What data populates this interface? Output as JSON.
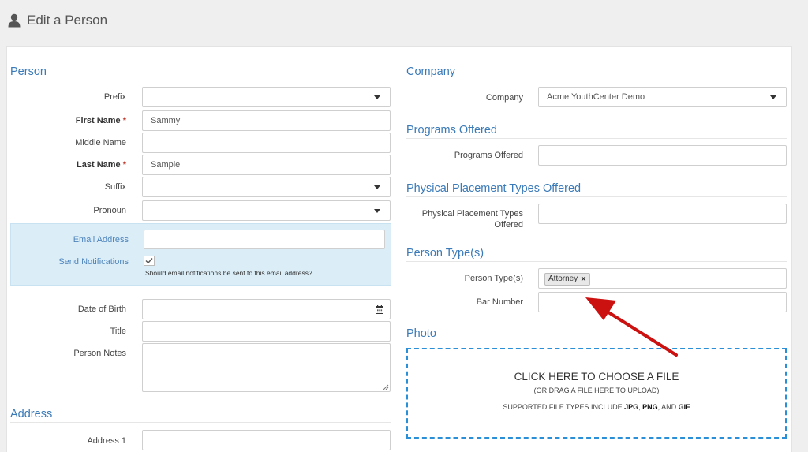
{
  "header": {
    "title": "Edit a Person",
    "icon": "user-icon"
  },
  "person": {
    "section_title": "Person",
    "prefix_label": "Prefix",
    "prefix_value": "",
    "first_name_label": "First Name",
    "first_name_value": "Sammy",
    "middle_name_label": "Middle Name",
    "middle_name_value": "",
    "last_name_label": "Last Name",
    "last_name_value": "Sample",
    "required_marker": "*",
    "suffix_label": "Suffix",
    "suffix_value": "",
    "pronoun_label": "Pronoun",
    "pronoun_value": "",
    "email_label": "Email Address",
    "email_value": "",
    "notifications_label": "Send Notifications",
    "notifications_checked": true,
    "notifications_help": "Should email notifications be sent to this email address?",
    "dob_label": "Date of Birth",
    "dob_value": "",
    "title_label": "Title",
    "title_value": "",
    "notes_label": "Person Notes",
    "notes_value": ""
  },
  "address": {
    "section_title": "Address",
    "address1_label": "Address 1",
    "address1_value": ""
  },
  "company": {
    "section_title": "Company",
    "company_label": "Company",
    "company_value": "Acme YouthCenter Demo"
  },
  "programs": {
    "section_title": "Programs Offered",
    "programs_label": "Programs Offered",
    "programs_value": ""
  },
  "placement": {
    "section_title": "Physical Placement Types Offered",
    "placement_label": "Physical Placement Types Offered",
    "placement_value": ""
  },
  "person_types": {
    "section_title": "Person Type(s)",
    "types_label": "Person Type(s)",
    "tags": [
      "Attorney"
    ],
    "tag_remove": "×",
    "bar_number_label": "Bar Number",
    "bar_number_value": ""
  },
  "photo": {
    "section_title": "Photo",
    "choose_text": "CLICK HERE TO CHOOSE A FILE",
    "drag_text": "(OR DRAG A FILE HERE TO UPLOAD)",
    "types_prefix": "SUPPORTED FILE TYPES INCLUDE ",
    "type_jpg": "JPG",
    "sep1": ", ",
    "type_png": "PNG",
    "sep2": ", AND ",
    "type_gif": "GIF"
  },
  "colors": {
    "accent": "#3a7ab8",
    "required": "#c0392b",
    "arrow": "#cc1111",
    "dropzone_border": "#2a8fd6",
    "email_bg": "#dbeef8"
  }
}
